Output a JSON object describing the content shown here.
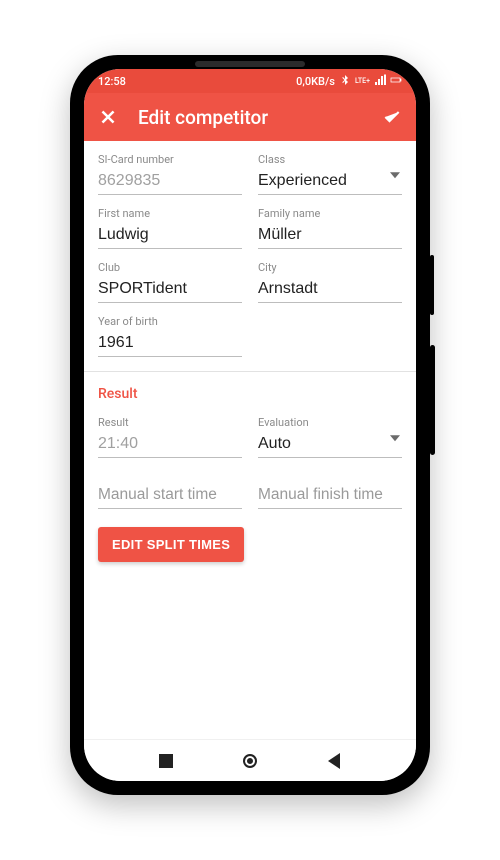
{
  "status": {
    "time": "12:58",
    "net_speed": "0,0KB/s",
    "net_label": "LTE+"
  },
  "appbar": {
    "title": "Edit competitor"
  },
  "form": {
    "si_card": {
      "label": "SI-Card number",
      "value": "8629835"
    },
    "class": {
      "label": "Class",
      "value": "Experienced"
    },
    "first_name": {
      "label": "First name",
      "value": "Ludwig"
    },
    "family_name": {
      "label": "Family name",
      "value": "Müller"
    },
    "club": {
      "label": "Club",
      "value": "SPORTident"
    },
    "city": {
      "label": "City",
      "value": "Arnstadt"
    },
    "yob": {
      "label": "Year of birth",
      "value": "1961"
    }
  },
  "result": {
    "section_title": "Result",
    "result": {
      "label": "Result",
      "value": "21:40"
    },
    "evaluation": {
      "label": "Evaluation",
      "value": "Auto"
    },
    "manual_start_placeholder": "Manual start time",
    "manual_finish_placeholder": "Manual finish time",
    "edit_split_button": "EDIT SPLIT TIMES"
  }
}
